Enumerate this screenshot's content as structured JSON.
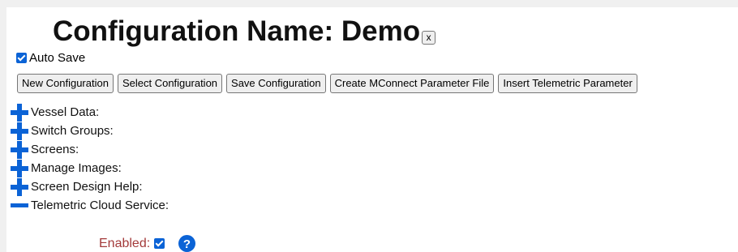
{
  "header": {
    "title": "Configuration Name: Demo",
    "close_label": "x"
  },
  "auto_save": {
    "label": "Auto Save",
    "checked": true
  },
  "toolbar": {
    "new_configuration": "New Configuration",
    "select_configuration": "Select Configuration",
    "save_configuration": "Save Configuration",
    "create_mconnect_file": "Create MConnect Parameter File",
    "insert_telemetric_parameter": "Insert Telemetric Parameter"
  },
  "sections": [
    {
      "label": "Vessel Data:",
      "icon": "plus-icon",
      "expanded": false
    },
    {
      "label": "Switch Groups:",
      "icon": "plus-icon",
      "expanded": false
    },
    {
      "label": "Screens:",
      "icon": "plus-icon",
      "expanded": false
    },
    {
      "label": "Manage Images:",
      "icon": "plus-icon",
      "expanded": false
    },
    {
      "label": "Screen Design Help:",
      "icon": "plus-icon",
      "expanded": false
    },
    {
      "label": "Telemetric Cloud Service:",
      "icon": "minus-icon",
      "expanded": true
    }
  ],
  "telemetric": {
    "enabled_label": "Enabled:",
    "enabled_checked": true,
    "help_icon": "question-circle-icon"
  },
  "colors": {
    "accent_blue": "#0b63d6",
    "enabled_label": "#a33a3a"
  }
}
